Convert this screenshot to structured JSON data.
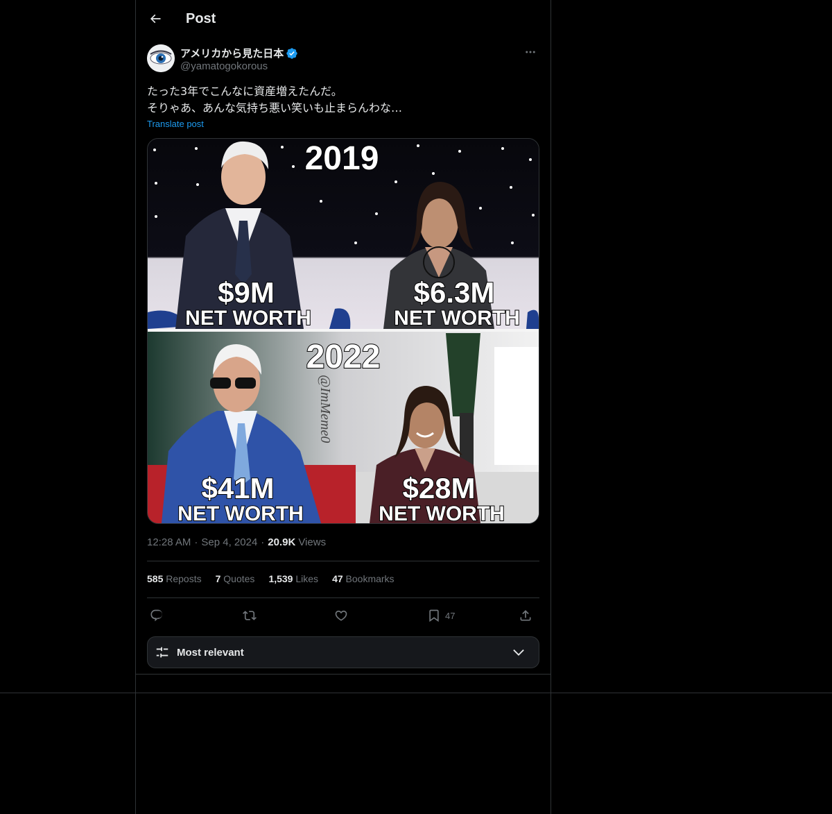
{
  "header": {
    "title": "Post"
  },
  "author": {
    "name": "アメリカから見た日本",
    "handle": "@yamatogokorous"
  },
  "post": {
    "lines": [
      "たった3年でこんなに資産増えたんだ。",
      "そりゃあ、あんな気持ち悪い笑いも止まらんわな…"
    ],
    "translate": "Translate post"
  },
  "media": {
    "year_top": "2019",
    "year_bottom": "2022",
    "left_top_amount": "$9M",
    "right_top_amount": "$6.3M",
    "left_bottom_amount": "$41M",
    "right_bottom_amount": "$28M",
    "caption": "NET WORTH",
    "watermark": "@ImMeme0"
  },
  "meta": {
    "time": "12:28 AM",
    "date": "Sep 4, 2024",
    "views_count": "20.9K",
    "views_label": "Views"
  },
  "stats": {
    "reposts": {
      "num": "585",
      "label": "Reposts"
    },
    "quotes": {
      "num": "7",
      "label": "Quotes"
    },
    "likes": {
      "num": "1,539",
      "label": "Likes"
    },
    "bookmarks": {
      "num": "47",
      "label": "Bookmarks"
    }
  },
  "actions": {
    "bookmark_count": "47"
  },
  "sort": {
    "label": "Most relevant"
  },
  "colors": {
    "accent": "#1d9bf0",
    "bg": "#000000",
    "border": "#2f3336",
    "muted": "#71767b"
  },
  "icons": [
    "back-arrow-icon",
    "verified-badge-icon",
    "more-icon",
    "reply-icon",
    "repost-icon",
    "like-icon",
    "bookmark-icon",
    "share-icon",
    "sliders-icon",
    "chevron-down-icon"
  ]
}
